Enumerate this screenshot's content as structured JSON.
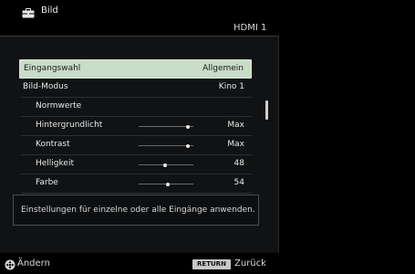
{
  "header": {
    "title": "Bild",
    "source": "HDMI 1"
  },
  "menu": {
    "items": [
      {
        "label": "Eingangswahl",
        "value": "Allgemein",
        "selected": true,
        "indent": false
      },
      {
        "label": "Bild-Modus",
        "value": "Kino 1",
        "selected": false,
        "indent": false
      },
      {
        "label": "Normwerte",
        "value": "",
        "selected": false,
        "indent": true
      },
      {
        "label": "Hintergrundlicht",
        "value": "Max",
        "selected": false,
        "indent": true,
        "slider": 0.9
      },
      {
        "label": "Kontrast",
        "value": "Max",
        "selected": false,
        "indent": true,
        "slider": 0.9
      },
      {
        "label": "Helligkeit",
        "value": "48",
        "selected": false,
        "indent": true,
        "slider": 0.48
      },
      {
        "label": "Farbe",
        "value": "54",
        "selected": false,
        "indent": true,
        "slider": 0.54
      }
    ]
  },
  "info": {
    "text": "Einstellungen für einzelne oder alle Eingänge anwenden."
  },
  "footer": {
    "change_label": "Ändern",
    "return_key": "RETURN",
    "back_label": "Zurück"
  },
  "icons": {
    "header": "toolbox-icon",
    "footer_nav": "dpad-icon"
  },
  "colors": {
    "selection": "#c8dcc8",
    "background": "#000000",
    "panel": "#101214"
  }
}
